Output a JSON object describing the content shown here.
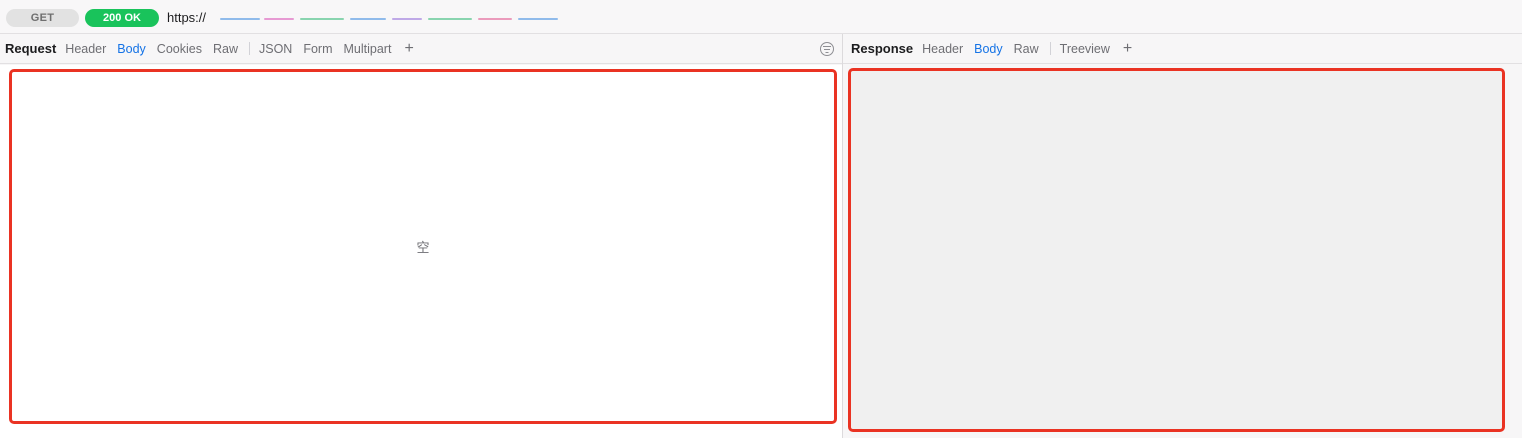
{
  "request_line": {
    "method": "GET",
    "status": "200 OK",
    "url_scheme": "https://"
  },
  "request_panel": {
    "title": "Request",
    "tabs": [
      {
        "label": "Header",
        "active": false
      },
      {
        "label": "Body",
        "active": true
      },
      {
        "label": "Cookies",
        "active": false
      },
      {
        "label": "Raw",
        "active": false
      }
    ],
    "format_tabs": [
      {
        "label": "JSON"
      },
      {
        "label": "Form"
      },
      {
        "label": "Multipart"
      }
    ],
    "add_label": "+",
    "empty_text": "空"
  },
  "response_panel": {
    "title": "Response",
    "tabs": [
      {
        "label": "Header",
        "active": false
      },
      {
        "label": "Body",
        "active": true
      },
      {
        "label": "Raw",
        "active": false
      }
    ],
    "extra_tabs": [
      {
        "label": "Treeview"
      }
    ],
    "add_label": "+"
  },
  "colors": {
    "status_green": "#19c35b",
    "active_tab": "#1573e6",
    "highlight_frame": "#ea3323"
  }
}
